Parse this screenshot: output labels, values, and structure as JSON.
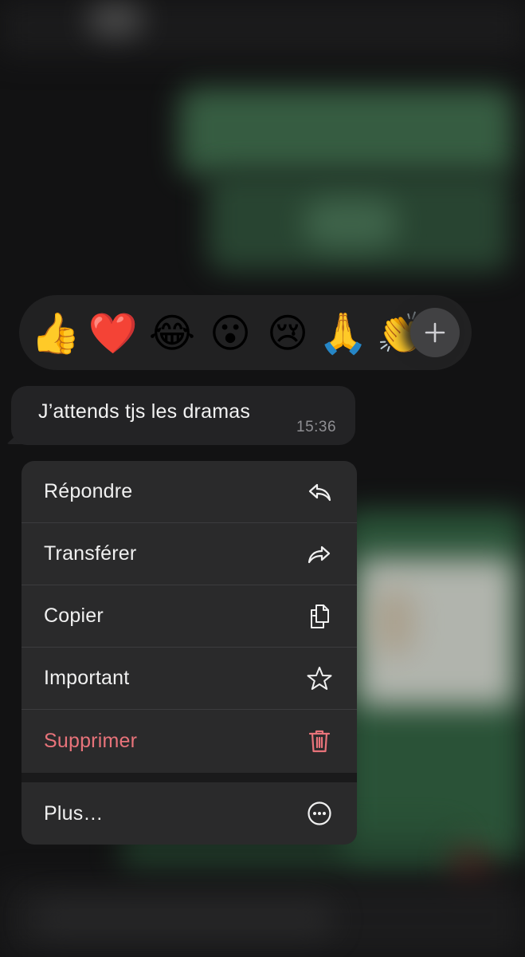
{
  "reactions": {
    "emojis": [
      "👍",
      "❤️",
      "😂",
      "😮",
      "😢",
      "🙏",
      "👏"
    ],
    "more_icon": "plus-icon"
  },
  "message": {
    "text": "J’attends tjs les dramas",
    "time": "15:36"
  },
  "menu": {
    "items": [
      {
        "label": "Répondre",
        "icon": "reply-icon"
      },
      {
        "label": "Transférer",
        "icon": "forward-icon"
      },
      {
        "label": "Copier",
        "icon": "copy-icon"
      },
      {
        "label": "Important",
        "icon": "star-icon"
      },
      {
        "label": "Supprimer",
        "icon": "trash-icon"
      },
      {
        "label": "Plus…",
        "icon": "more-icon"
      }
    ]
  },
  "colors": {
    "danger": "#e8737a",
    "menu_bg": "#2a2a2b",
    "bubble_bg": "#232325",
    "chat_green": "#2d5a3c"
  }
}
